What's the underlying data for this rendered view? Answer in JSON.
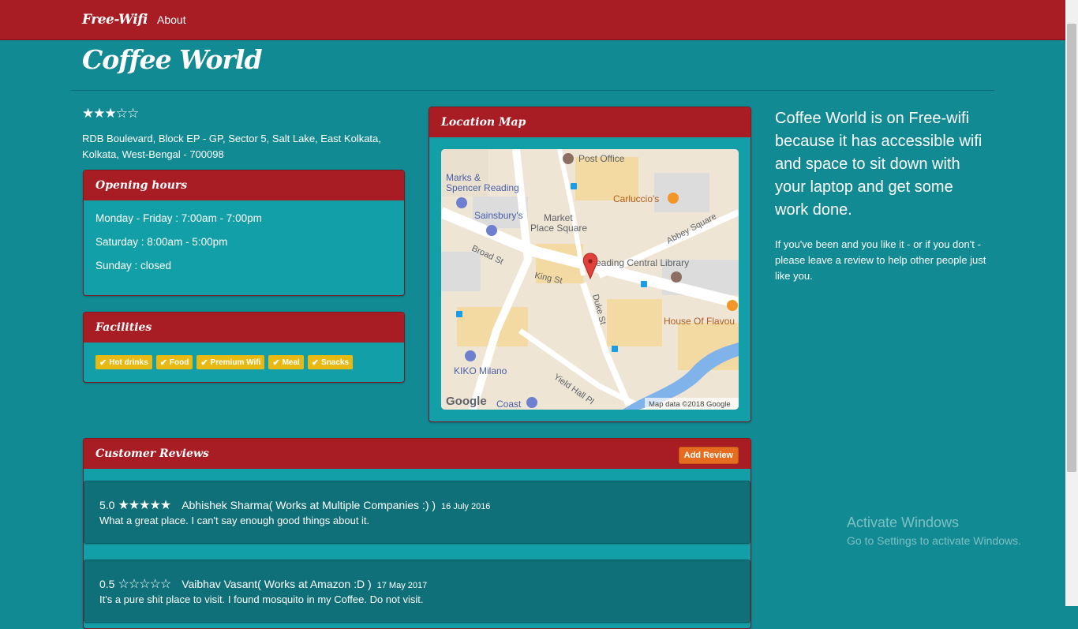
{
  "nav": {
    "brand": "Free-Wifi",
    "about": "About"
  },
  "page": {
    "title": "Coffee World",
    "rating_stars": "★★★☆☆"
  },
  "address": "RDB Boulevard, Block EP - GP, Sector 5, Salt Lake, East Kolkata, Kolkata, West-Bengal - 700098",
  "opening_hours": {
    "title": "Opening hours",
    "items": [
      "Monday - Friday : 7:00am - 7:00pm",
      "Saturday : 8:00am - 5:00pm",
      "Sunday : closed"
    ]
  },
  "facilities": {
    "title": "Facilities",
    "items": [
      "Hot drinks",
      "Food",
      "Premium Wifi",
      "Meal",
      "Snacks"
    ]
  },
  "location_map": {
    "title": "Location Map",
    "labels": {
      "post_office": "Post Office",
      "marks": "Marks &",
      "spencer": "Spencer Reading",
      "carluccio": "Carluccio's",
      "sainsbury": "Sainsbury's",
      "market": "Market",
      "place_square": "Place Square",
      "abbey": "Abbey Square",
      "broad": "Broad St",
      "king": "King St",
      "library": "eading Central Library",
      "duke": "Duke St",
      "house": "House Of Flavou",
      "kiko": "KIKO Milano",
      "yield": "Yield Hall Pl",
      "coast": "Coast",
      "google": "Google",
      "attribution": "Map data ©2018 Google"
    }
  },
  "about": {
    "heading": "Coffee World is on Free-wifi because it has accessible wifi and space to sit down with your laptop and get some work done.",
    "text": "If you've been and you like it - or if you don't - please leave a review to help other people just like you."
  },
  "reviews": {
    "title": "Customer Reviews",
    "add_label": "Add Review",
    "items": [
      {
        "score": "5.0",
        "stars": "★★★★★",
        "author": "Abhishek Sharma( Works at Multiple Companies :) )",
        "date": "16 July 2016",
        "text": "What a great place. I can't say enough good things about it."
      },
      {
        "score": "0.5",
        "stars": "☆☆☆☆☆",
        "author": "Vaibhav Vasant( Works at Amazon :D )",
        "date": "17 May 2017",
        "text": "It's a pure shit place to visit. I found mosquito in my Coffee. Do not visit."
      }
    ]
  },
  "watermark": {
    "title": "Activate Windows",
    "subtitle": "Go to Settings to activate Windows."
  },
  "colors": {
    "nav": "#a81c24",
    "background": "#118a93",
    "panel_body": "#139fa8",
    "badge": "#e8b913",
    "add_button": "#e66d1f"
  }
}
